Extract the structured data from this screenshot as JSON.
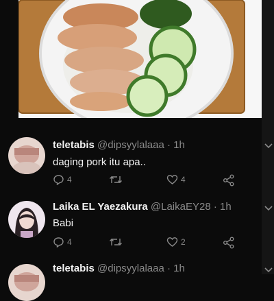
{
  "tweets": [
    {
      "name": "teletabis",
      "handle": "@dipsyylalaaa",
      "sep": "·",
      "time": "1h",
      "text": "daging pork itu apa..",
      "replies": "4",
      "likes": "4"
    },
    {
      "name": "Laika EL Yaezakura",
      "handle": "@LaikaEY28",
      "sep": "·",
      "time": "1h",
      "text": "Babi",
      "replies": "4",
      "likes": "2"
    },
    {
      "name": "teletabis",
      "handle": "@dipsyylalaaa",
      "sep": "·",
      "time": "1h"
    }
  ],
  "icons": {
    "reply": "reply-icon",
    "retweet": "retweet-icon",
    "like": "like-icon",
    "share": "share-icon",
    "menu": "chevron-down-icon"
  },
  "colors": {
    "background": "#0b0b0b",
    "text": "#f2f2f2",
    "muted": "#8a8a8a"
  }
}
